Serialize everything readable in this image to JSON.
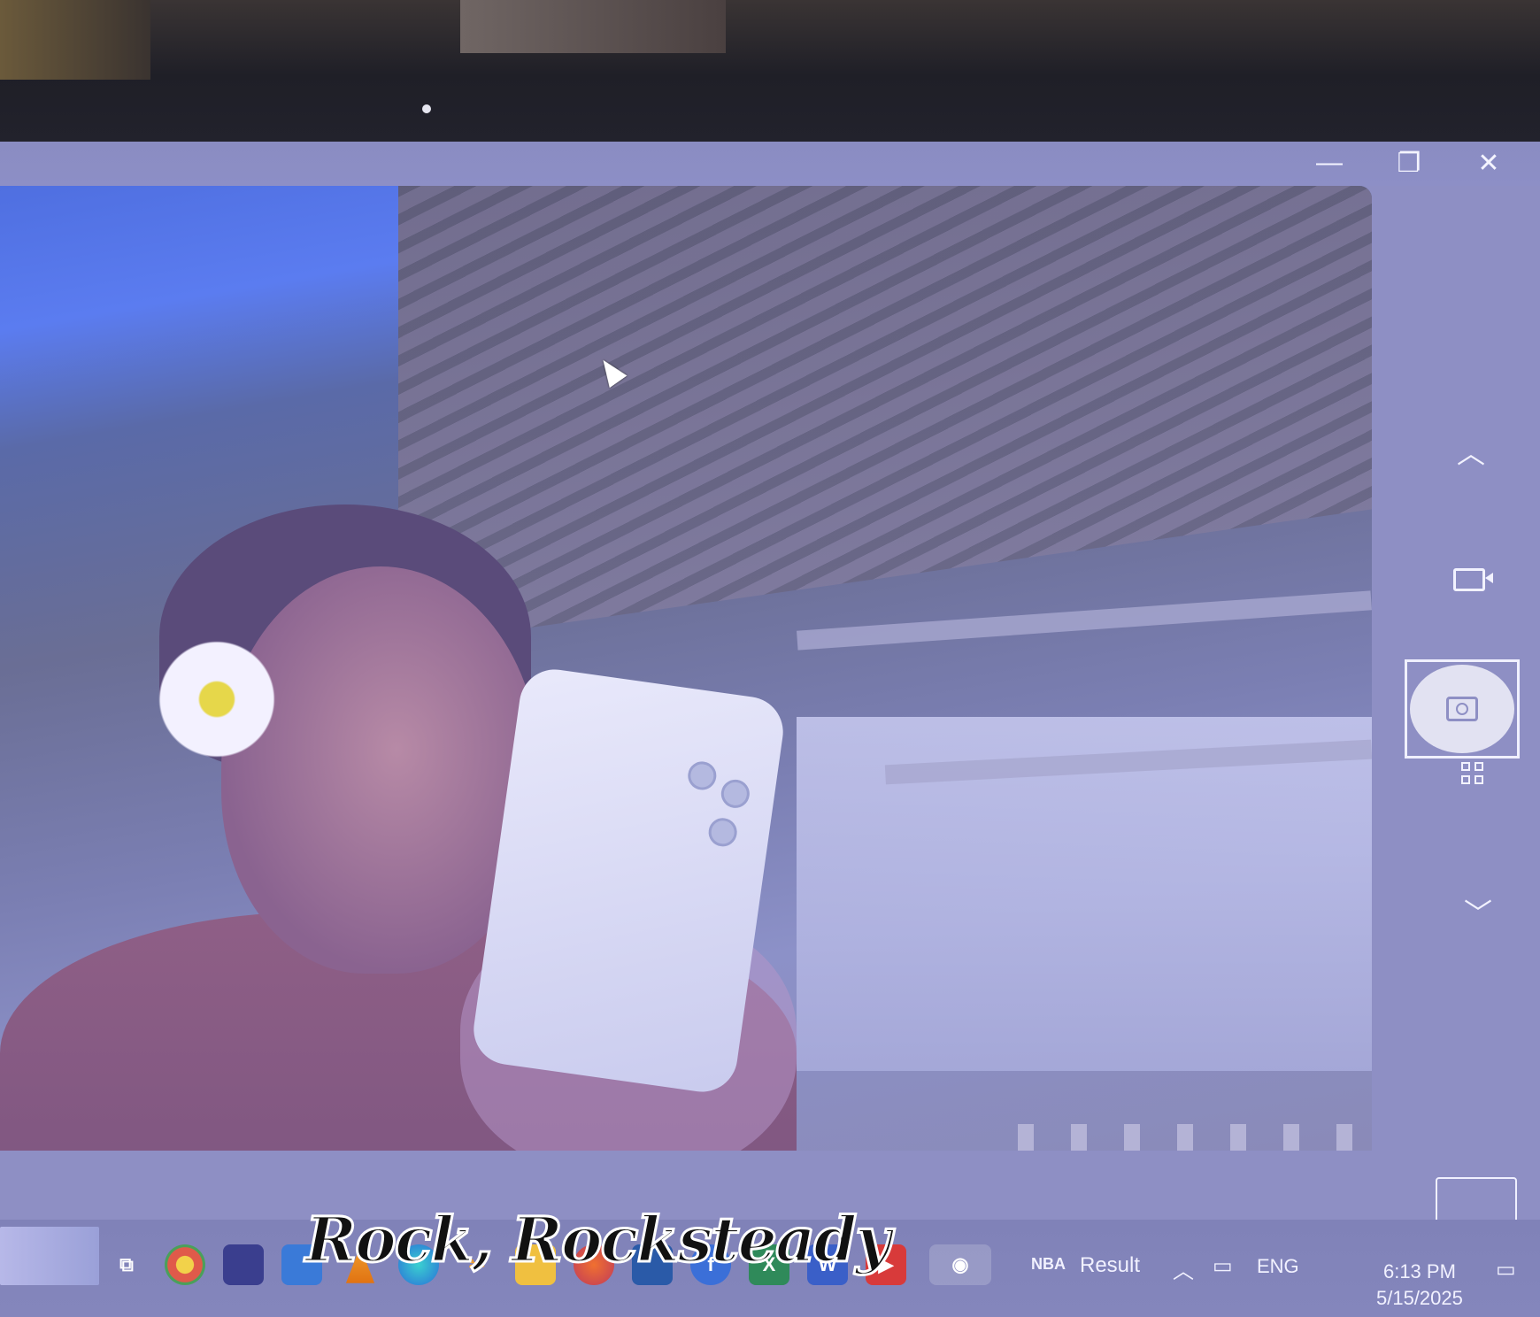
{
  "window": {
    "controls": {
      "minimize_glyph": "—",
      "maximize_glyph": "❐",
      "close_glyph": "✕"
    }
  },
  "camera_controls": {
    "scroll_up_glyph": "︿",
    "scroll_down_glyph": "﹀",
    "modes": [
      "video-icon",
      "photo-shutter",
      "qr-scan-icon"
    ]
  },
  "taskbar": {
    "pinned_icons": [
      "task-view-icon",
      "chrome-icon",
      "united-app-icon",
      "browser-icon",
      "vlc-icon",
      "edge-icon",
      "tool-icon",
      "file-explorer-icon",
      "firefox-icon",
      "app-icon",
      "facebook-icon",
      "excel-icon",
      "word-icon",
      "youtube-icon",
      "camera-icon"
    ],
    "tray": {
      "widget_label": "Result",
      "language": "ENG",
      "time": "6:13 PM",
      "date": "5/15/2025"
    }
  },
  "caption": {
    "text": "Rock, Rocksteady"
  },
  "colors": {
    "accent": "#8e8fc4",
    "facebook": "#3b6fd8",
    "excel": "#2f8a5a",
    "word": "#3a5fc8",
    "youtube": "#d83a3a",
    "vlc": "#f08a1a"
  }
}
